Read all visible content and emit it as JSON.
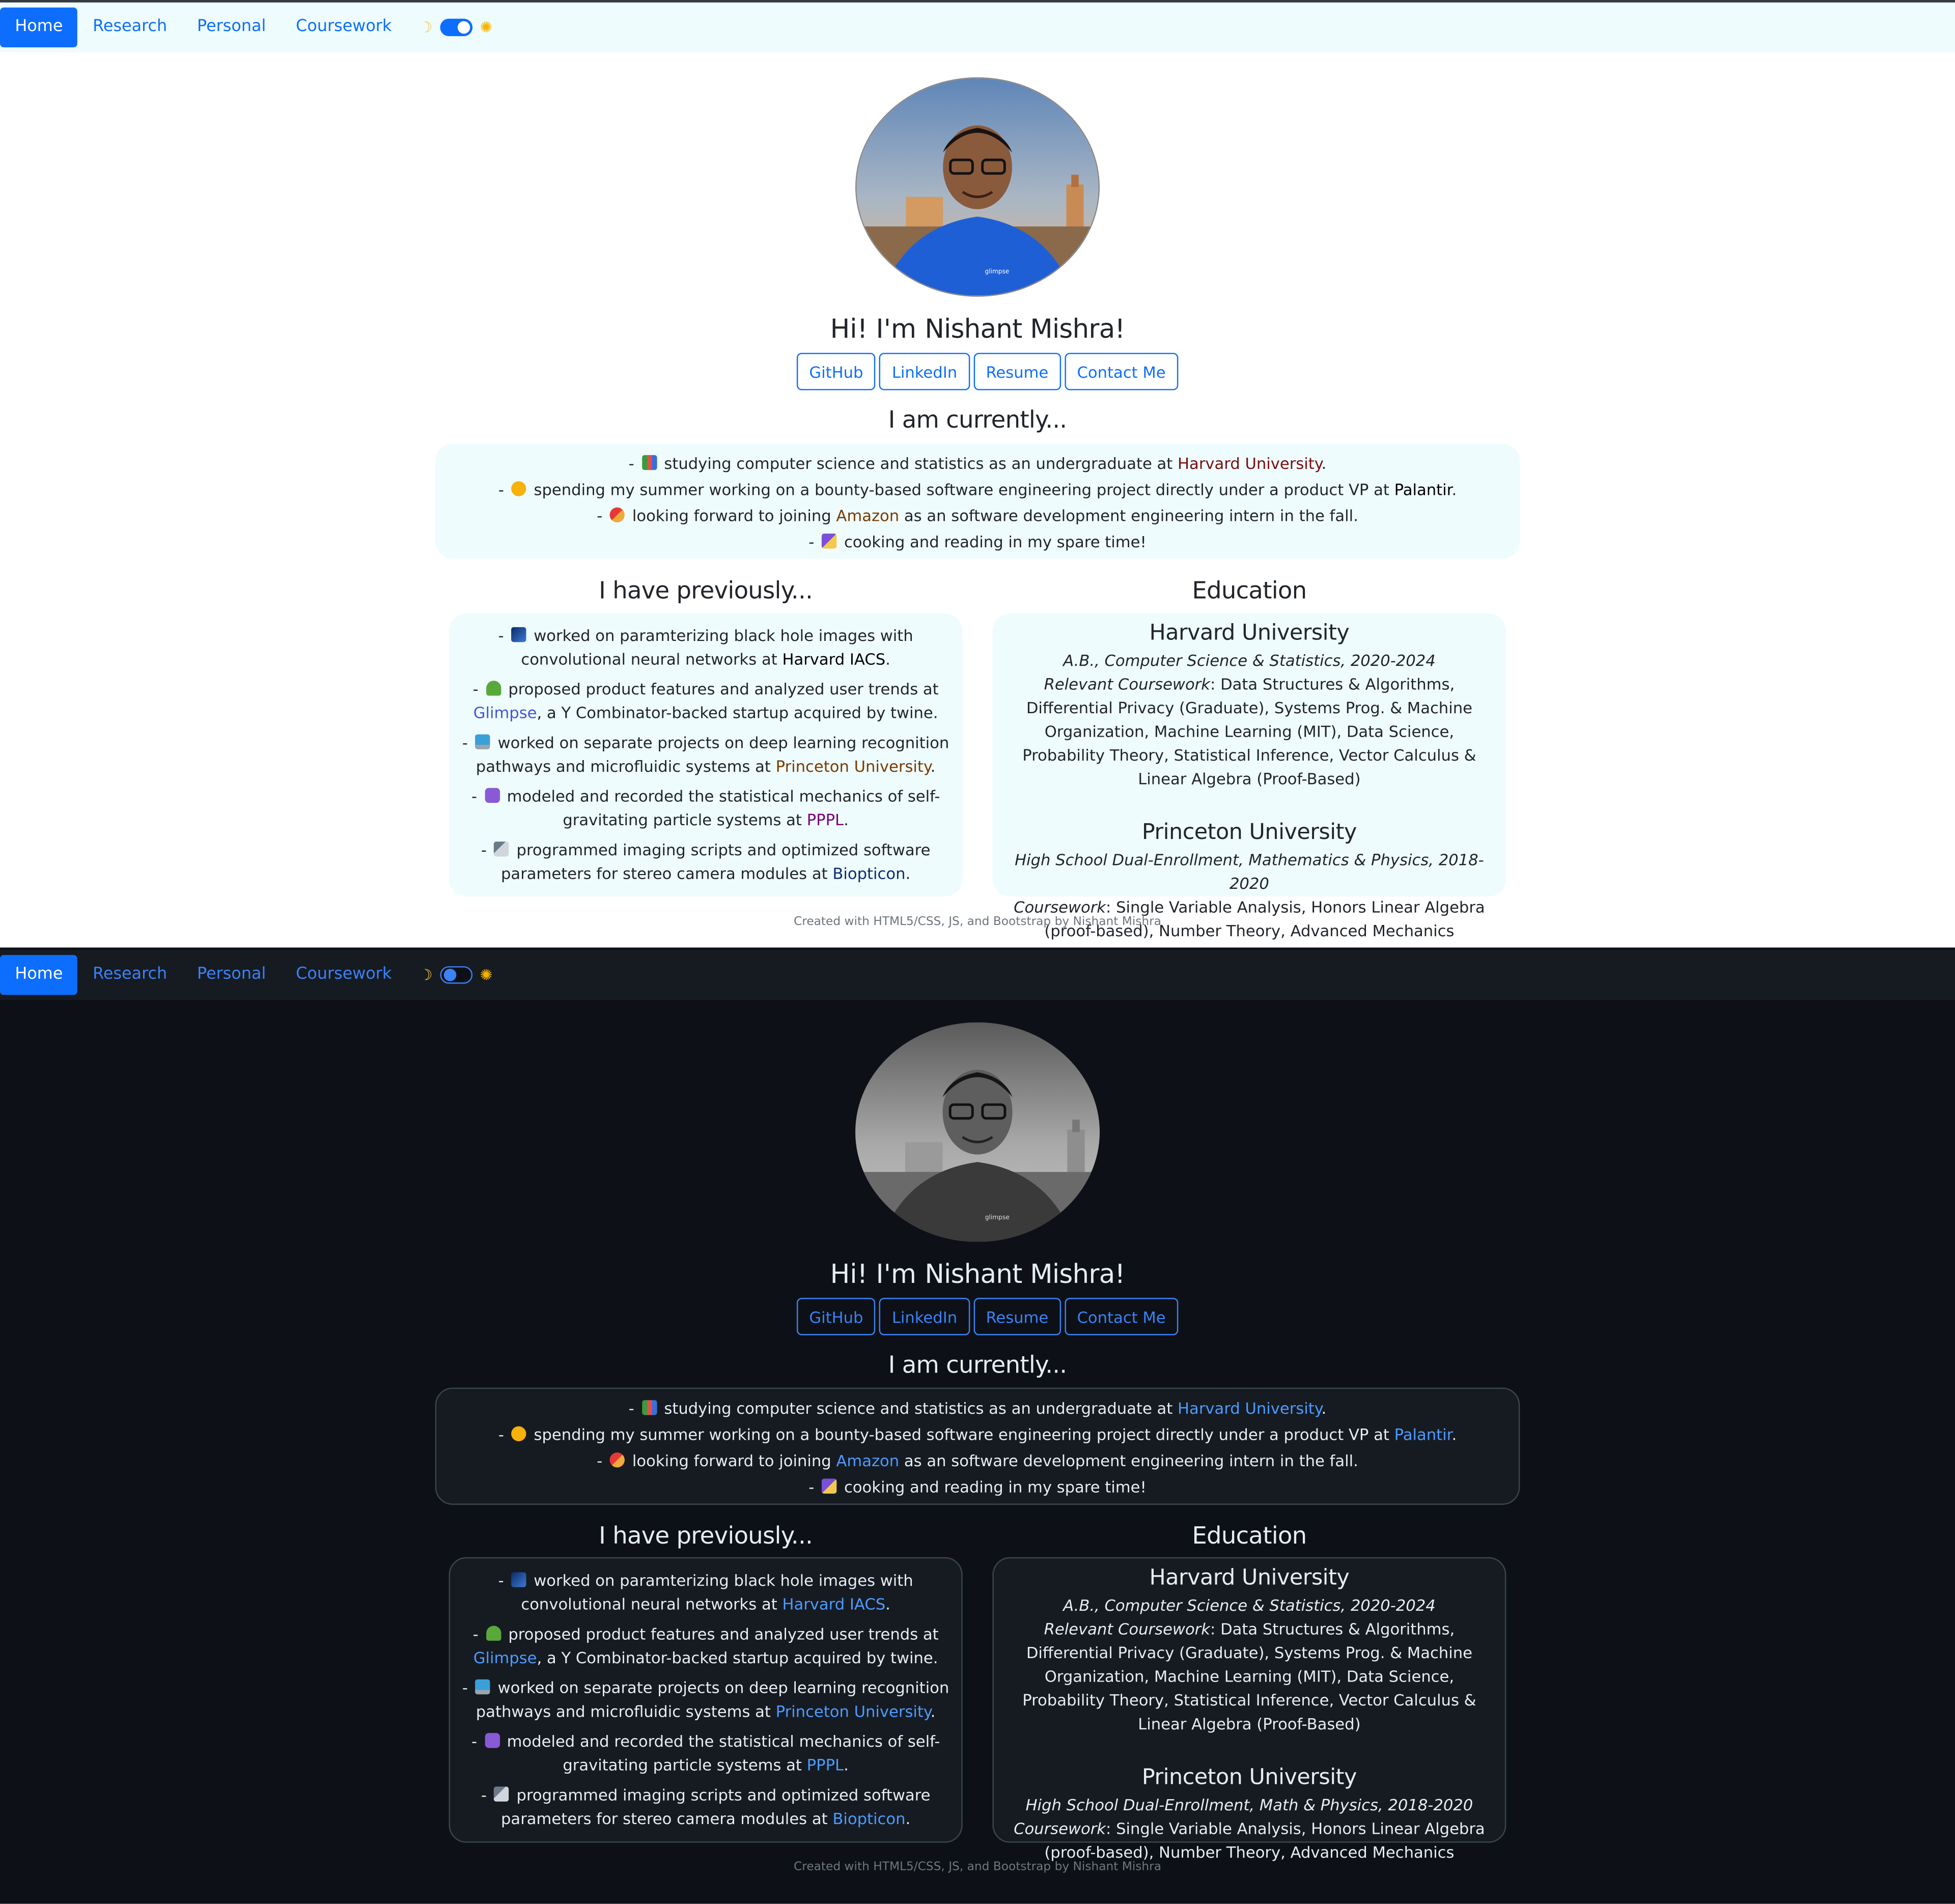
{
  "nav": {
    "items": [
      "Home",
      "Research",
      "Personal",
      "Coursework"
    ],
    "moon_icon": "☽",
    "sun_icon": "✺"
  },
  "greeting": {
    "prefix": "Hi! I'm ",
    "name": "Nishant Mishra!"
  },
  "buttons": [
    "GitHub",
    "LinkedIn",
    "Resume",
    "Contact Me"
  ],
  "currently": {
    "heading": "I am currently...",
    "items": [
      {
        "prefix": "- ",
        "icon": "books-icon",
        "text": " studying computer science and statistics as an undergraduate at ",
        "link": "Harvard University",
        "suffix": "."
      },
      {
        "prefix": "- ",
        "icon": "sun-icon",
        "text": " spending my summer working on a bounty-based software engineering project directly under a product VP at ",
        "link": "Palantir",
        "suffix": "."
      },
      {
        "prefix": "- ",
        "icon": "rocket-icon",
        "text": " looking forward to joining ",
        "link": "Amazon",
        "suffix": " as an software development engineering intern in the fall."
      },
      {
        "prefix": "- ",
        "icon": "party-icon",
        "text": " cooking and reading in my spare time!",
        "link": "",
        "suffix": ""
      }
    ]
  },
  "previously": {
    "heading": "I have previously...",
    "items": [
      {
        "icon": "galaxy-icon",
        "text": " worked on paramterizing black hole images with convolutional neural networks at ",
        "link": "Harvard IACS",
        "suffix": "."
      },
      {
        "icon": "seedling-icon",
        "text": " proposed product features and analyzed user trends at ",
        "link": "Glimpse",
        "suffix": ", a Y Combinator-backed startup acquired by twine."
      },
      {
        "icon": "laptop-icon",
        "text": " worked on separate projects on deep learning recognition pathways and microfluidic systems at ",
        "link": "Princeton University",
        "suffix": "."
      },
      {
        "icon": "atom-icon",
        "text": " modeled and recorded the statistical mechanics of self-gravitating particle systems at ",
        "link": "PPPL",
        "suffix": "."
      },
      {
        "icon": "telescope-icon",
        "text": " programmed imaging scripts and optimized software parameters for stereo camera modules at ",
        "link": "Biopticon",
        "suffix": "."
      }
    ]
  },
  "education": {
    "heading": "Education",
    "harvard": {
      "name": "Harvard University",
      "degree": "A.B., Computer Science & Statistics, 2020-2024",
      "cw_label": "Relevant Coursework",
      "cw_text": ": Data Structures & Algorithms, Differential Privacy (Graduate), Systems Prog. & Machine Organization, Machine Learning (MIT), Data Science, Probability Theory, Statistical Inference, Vector Calculus & Linear Algebra (Proof-Based)"
    },
    "princeton": {
      "name": "Princeton University",
      "degree_light": "High School Dual-Enrollment, Mathematics & Physics, 2018-2020",
      "degree_dark": "High School Dual-Enrollment, Math & Physics, 2018-2020",
      "cw_label": "Coursework",
      "cw_text": ": Single Variable Analysis, Honors Linear Algebra (proof-based), Number Theory, Advanced Mechanics"
    }
  },
  "footer": "Created with HTML5/CSS, JS, and Bootstrap by Nishant Mishra",
  "colors": {
    "accent": "#0d6efd",
    "light_panel": "#eefcfd",
    "dark_bg": "#0d1117",
    "dark_card": "#161b22"
  }
}
